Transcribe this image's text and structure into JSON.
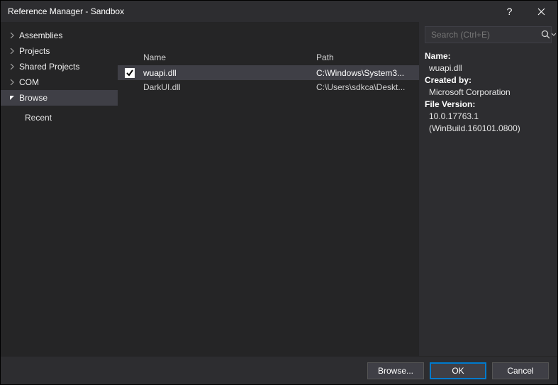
{
  "window": {
    "title": "Reference Manager - Sandbox"
  },
  "sidebar": {
    "items": [
      {
        "label": "Assemblies",
        "expanded": false
      },
      {
        "label": "Projects",
        "expanded": false
      },
      {
        "label": "Shared Projects",
        "expanded": false
      },
      {
        "label": "COM",
        "expanded": false
      },
      {
        "label": "Browse",
        "expanded": true,
        "selected": true
      }
    ],
    "sub": {
      "label": "Recent"
    }
  },
  "columns": {
    "name": "Name",
    "path": "Path"
  },
  "rows": [
    {
      "checked": true,
      "selected": true,
      "name": "wuapi.dll",
      "path": "C:\\Windows\\System3..."
    },
    {
      "checked": false,
      "selected": false,
      "name": "DarkUI.dll",
      "path": "C:\\Users\\sdkca\\Deskt..."
    }
  ],
  "search": {
    "placeholder": "Search (Ctrl+E)"
  },
  "details": {
    "name_label": "Name:",
    "name_value": "wuapi.dll",
    "created_label": "Created by:",
    "created_value": "Microsoft Corporation",
    "version_label": "File Version:",
    "version_value": "10.0.17763.1",
    "build_value": "(WinBuild.160101.0800)"
  },
  "footer": {
    "browse": "Browse...",
    "ok": "OK",
    "cancel": "Cancel"
  }
}
